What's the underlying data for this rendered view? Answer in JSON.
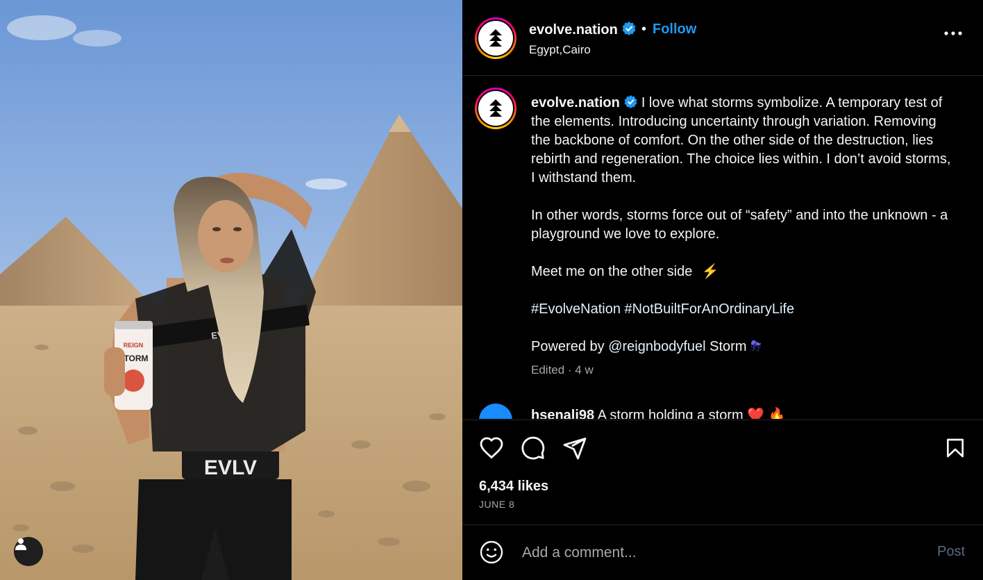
{
  "post": {
    "username": "evolve.nation",
    "separator": "•",
    "follow_label": "Follow",
    "location": "Egypt,Cairo"
  },
  "caption": {
    "username": "evolve.nation",
    "paragraph1": "I love what storms symbolize. A temporary test of the elements. Introducing uncertainty through variation. Removing the backbone of comfort. On the other side of the destruction, lies rebirth and regeneration. The choice lies within. I don’t avoid storms, I withstand them.",
    "paragraph2": "In other words, storms force out of “safety” and into the unknown - a playground we love to explore.",
    "paragraph3": "Meet me on the other side",
    "paragraph3_emoji": "⚡",
    "hashtags": "#EvolveNation #NotBuiltForAnOrdinaryLife",
    "powered_prefix": "Powered by",
    "powered_mention": "@reignbodyfuel",
    "powered_suffix": "Storm",
    "powered_emoji": "⛈",
    "meta": "Edited · 4 w"
  },
  "comment": {
    "username": "hsenali98",
    "text": "A storm holding a storm",
    "emojis": "❤️ 🔥"
  },
  "engagement": {
    "likes": "6,434 likes",
    "date": "JUNE 8"
  },
  "comment_box": {
    "placeholder": "Add a comment...",
    "post_label": "Post"
  },
  "media": {
    "shirt_text": "EVLV",
    "waistband_text": "EVLV",
    "can_brand": "REIGN",
    "can_name": "STORM"
  },
  "colors": {
    "follow": "#1d9bf0",
    "verified": "#1d9bf0",
    "post_disabled": "#5a6b7d",
    "background": "#000000"
  }
}
